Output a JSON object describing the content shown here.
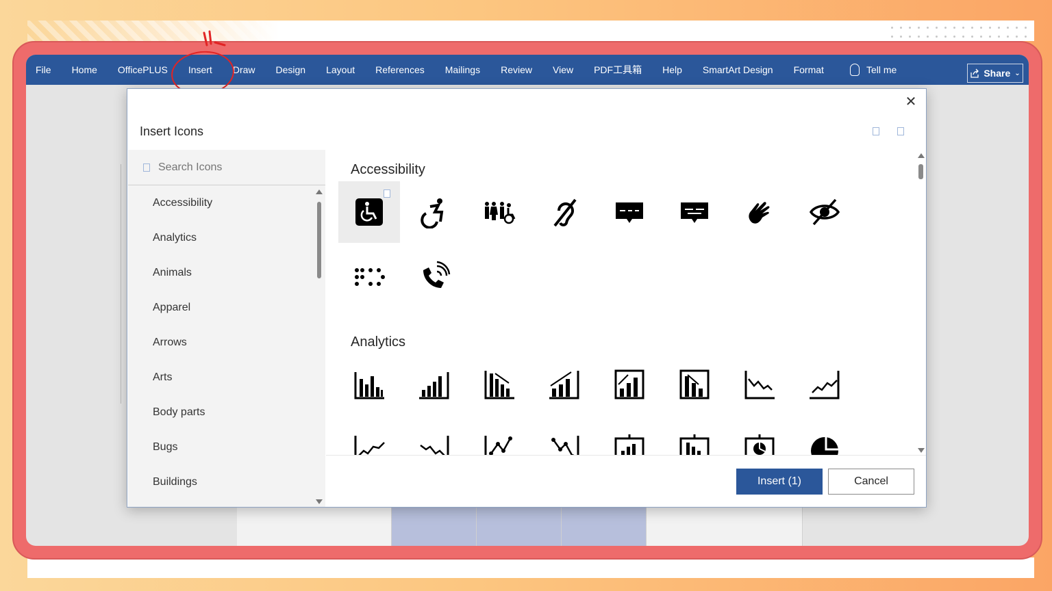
{
  "ribbon": {
    "tabs": [
      "File",
      "Home",
      "OfficePLUS",
      "Insert",
      "Draw",
      "Design",
      "Layout",
      "References",
      "Mailings",
      "Review",
      "View",
      "PDF工具箱",
      "Help",
      "SmartArt Design",
      "Format"
    ],
    "tell_me": "Tell me",
    "share": "Share"
  },
  "dialog": {
    "title": "Insert Icons",
    "close": "✕",
    "search_placeholder": "Search Icons",
    "categories": [
      "Accessibility",
      "Analytics",
      "Animals",
      "Apparel",
      "Arrows",
      "Arts",
      "Body parts",
      "Bugs",
      "Buildings"
    ],
    "sections": [
      {
        "title": "Accessibility",
        "icons": [
          "wheelchair-sign-icon",
          "active-wheelchair-icon",
          "family-accessible-icon",
          "hearing-impaired-icon",
          "closed-captioning-icon",
          "open-captioning-icon",
          "sign-language-icon",
          "low-vision-icon",
          "braille-icon",
          "volume-phone-icon"
        ]
      },
      {
        "title": "Analytics",
        "icons": [
          "bar-chart-icon",
          "bar-chart-ascending-icon",
          "bar-chart-descending-icon",
          "bar-graph-upward-trend-icon",
          "bar-graph-upward-arrow-icon",
          "bar-graph-downward-arrow-icon",
          "line-downward-trend-icon",
          "line-upward-trend-icon",
          "line-arrow-up-icon",
          "line-arrow-down-icon",
          "line-chart-points-icon",
          "line-chart-descending-points-icon",
          "presentation-bar-chart-icon",
          "presentation-bar-chart-descending-icon",
          "presentation-pie-chart-icon",
          "pie-chart-icon"
        ]
      }
    ],
    "insert_label": "Insert (1)",
    "cancel_label": "Cancel"
  },
  "colors": {
    "ribbon": "#2b579a",
    "frame": "#ee6b6b",
    "annotation": "#e22424"
  }
}
